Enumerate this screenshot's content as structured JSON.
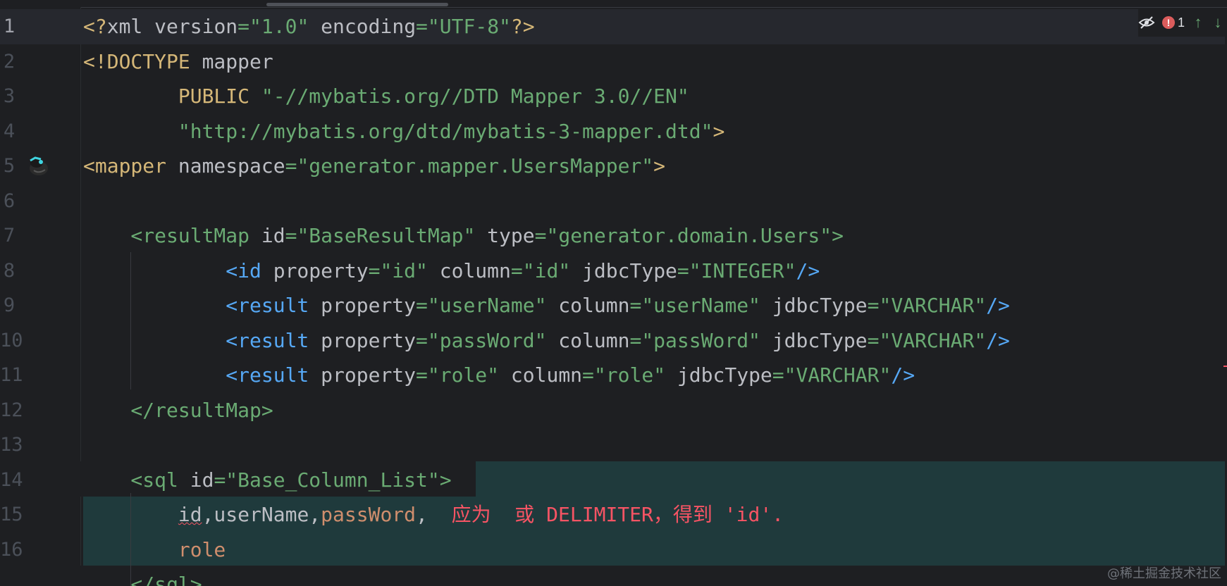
{
  "editor": {
    "language": "xml",
    "current_line": 1,
    "lines": [
      {
        "n": "1"
      },
      {
        "n": "2"
      },
      {
        "n": "3"
      },
      {
        "n": "4"
      },
      {
        "n": "5"
      },
      {
        "n": "6"
      },
      {
        "n": "7"
      },
      {
        "n": "8"
      },
      {
        "n": "9"
      },
      {
        "n": "10"
      },
      {
        "n": "11"
      },
      {
        "n": "12"
      },
      {
        "n": "13"
      },
      {
        "n": "14"
      },
      {
        "n": "15"
      },
      {
        "n": "16"
      }
    ],
    "code": {
      "l1": {
        "a": "<?",
        "b": "xml ",
        "c": "version",
        "d": "=",
        "e": "\"1.0\"",
        "f": " encoding",
        "g": "=",
        "h": "\"UTF-8\"",
        "i": "?>"
      },
      "l2": {
        "a": "<!DOCTYPE ",
        "b": "mapper"
      },
      "l3": {
        "a": "        PUBLIC ",
        "b": "\"-//mybatis.org//DTD Mapper 3.0//EN\""
      },
      "l4": {
        "a": "        ",
        "b": "\"http://mybatis.org/dtd/mybatis-3-mapper.dtd\"",
        "c": ">"
      },
      "l5": {
        "a": "<mapper ",
        "b": "namespace",
        "c": "=",
        "d": "\"generator.mapper.UsersMapper\"",
        "e": ">"
      },
      "l7": {
        "a": "    <resultMap ",
        "b": "id",
        "c": "=",
        "d": "\"BaseResultMap\"",
        "e": " type",
        "f": "=",
        "g": "\"generator.domain.Users\"",
        "h": ">"
      },
      "l8": {
        "a": "            <id ",
        "b": "property",
        "c": "=",
        "d": "\"id\"",
        "e": " column",
        "f": "=",
        "g": "\"id\"",
        "h": " jdbcType",
        "i": "=",
        "j": "\"INTEGER\"",
        "k": "/>"
      },
      "l9": {
        "a": "            <result ",
        "b": "property",
        "c": "=",
        "d": "\"userName\"",
        "e": " column",
        "f": "=",
        "g": "\"userName\"",
        "h": " jdbcType",
        "i": "=",
        "j": "\"VARCHAR\"",
        "k": "/>"
      },
      "l10": {
        "a": "            <result ",
        "b": "property",
        "c": "=",
        "d": "\"passWord\"",
        "e": " column",
        "f": "=",
        "g": "\"passWord\"",
        "h": " jdbcType",
        "i": "=",
        "j": "\"VARCHAR\"",
        "k": "/>"
      },
      "l11": {
        "a": "            <result ",
        "b": "property",
        "c": "=",
        "d": "\"role\"",
        "e": " column",
        "f": "=",
        "g": "\"role\"",
        "h": " jdbcType",
        "i": "=",
        "j": "\"VARCHAR\"",
        "k": "/>"
      },
      "l12": {
        "a": "    </resultMap>"
      },
      "l14": {
        "a": "    <sql ",
        "b": "id",
        "c": "=",
        "d": "\"Base_Column_List\"",
        "e": ">"
      },
      "l15": {
        "a": "        ",
        "b": "id",
        "c": ",userName,",
        "d": "passWord",
        "e": ",  ",
        "f": "应为  或 DELIMITER，得到 'id'."
      },
      "l16": {
        "a": "        ",
        "b": "role"
      },
      "l17": {
        "a": "    </sql>"
      }
    }
  },
  "inspections": {
    "eye_icon": "eye-crossed-icon",
    "error_count": "1",
    "error_icon": "error-circle-icon",
    "error_glyph": "!",
    "up_arrow": "↑",
    "down_arrow": "↓"
  },
  "watermark": "@稀土掘金技术社区",
  "colors": {
    "background": "#1e1f22",
    "tag": "#d5b778",
    "string": "#6aab73",
    "attribute": "#bcbec4",
    "error": "#f75464",
    "selection": "#1f3a3c"
  }
}
